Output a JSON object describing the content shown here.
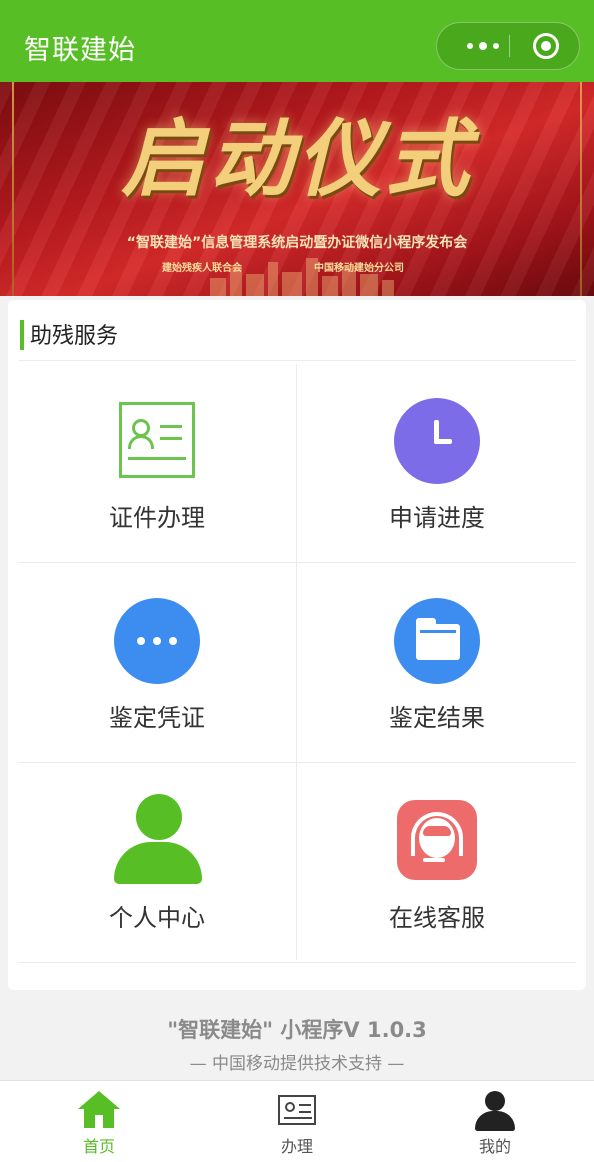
{
  "app": {
    "title": "智联建始"
  },
  "banner": {
    "headline": "启动仪式",
    "subtitle": "“智联建始”信息管理系统启动暨办证微信小程序发布会",
    "org_left": "建始残疾人联合会",
    "org_right": "中国移动建始分公司"
  },
  "section": {
    "title": "助残服务"
  },
  "services": [
    {
      "label": "证件办理",
      "icon": "id-card-icon",
      "color": "#6cc34e"
    },
    {
      "label": "申请进度",
      "icon": "clock-icon",
      "color": "#7c6ce8"
    },
    {
      "label": "鉴定凭证",
      "icon": "chat-dots-icon",
      "color": "#3d8df0"
    },
    {
      "label": "鉴定结果",
      "icon": "folder-icon",
      "color": "#3d8df0"
    },
    {
      "label": "个人中心",
      "icon": "person-icon",
      "color": "#57bf25"
    },
    {
      "label": "在线客服",
      "icon": "customer-service-icon",
      "color": "#ee6b6b"
    }
  ],
  "footer": {
    "line1": "\"智联建始\" 小程序V 1.0.3",
    "line2": "— 中国移动提供技术支持 —"
  },
  "tabbar": [
    {
      "label": "首页",
      "icon": "home-icon",
      "active": true
    },
    {
      "label": "办理",
      "icon": "id-card-icon",
      "active": false
    },
    {
      "label": "我的",
      "icon": "person-icon",
      "active": false
    }
  ],
  "colors": {
    "brand": "#57bf25",
    "header_bg": "#57bf25",
    "banner_red": "#b81a1e"
  }
}
